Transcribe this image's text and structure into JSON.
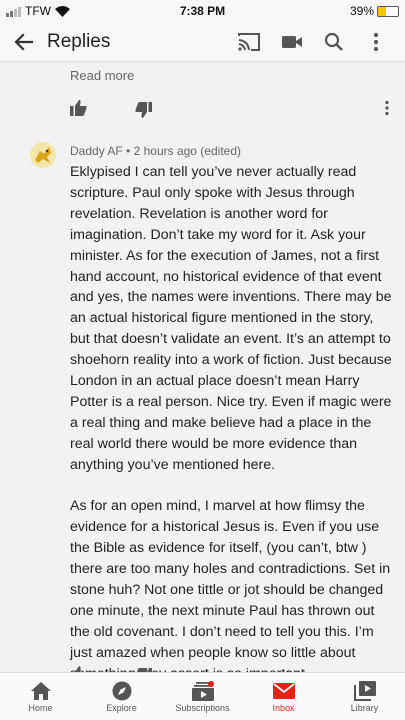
{
  "status_bar": {
    "carrier": "TFW",
    "time": "7:38 PM",
    "battery": "39%"
  },
  "header": {
    "title": "Replies"
  },
  "previous_comment": {
    "read_more": "Read more"
  },
  "comment": {
    "author": "Daddy AF",
    "meta": "2 hours ago (edited)",
    "paragraphs": [
      "Eklypised  I can tell you’ve never actually read scripture. Paul only spoke with Jesus through revelation. Revelation is another word for imagination. Don’t take my word for it. Ask your minister. As for the execution of James, not a first hand account, no historical evidence of that event and yes, the names were inventions. There may be an actual historical figure mentioned in the story, but that doesn’t validate an event. It’s an attempt to shoehorn reality into a work of fiction. Just because London in an actual place doesn’t mean Harry Potter is a real person. Nice try. Even if magic were a real thing and make believe had a place in the real world there would be more evidence than anything you’ve mentioned here.",
      "As for an open mind, I marvel at how flimsy the evidence for a historical Jesus is. Even if you use the Bible as evidence for itself, (you can’t, btw ) there are too many holes and contradictions. Set in stone huh? Not one tittle or jot should be changed one minute, the next minute Paul has thrown out the old covenant. I don’t need to tell you this. I’m just amazed when people know so little about something they assert is so important."
    ]
  },
  "bottom_nav": [
    {
      "label": "Home",
      "icon": "home-icon"
    },
    {
      "label": "Explore",
      "icon": "explore-icon"
    },
    {
      "label": "Subscriptions",
      "icon": "subscriptions-icon"
    },
    {
      "label": "Inbox",
      "icon": "inbox-icon"
    },
    {
      "label": "Library",
      "icon": "library-icon"
    }
  ],
  "colors": {
    "accent": "#e62117",
    "text": "#222222",
    "muted": "#666666",
    "battery": "#f2c500"
  }
}
